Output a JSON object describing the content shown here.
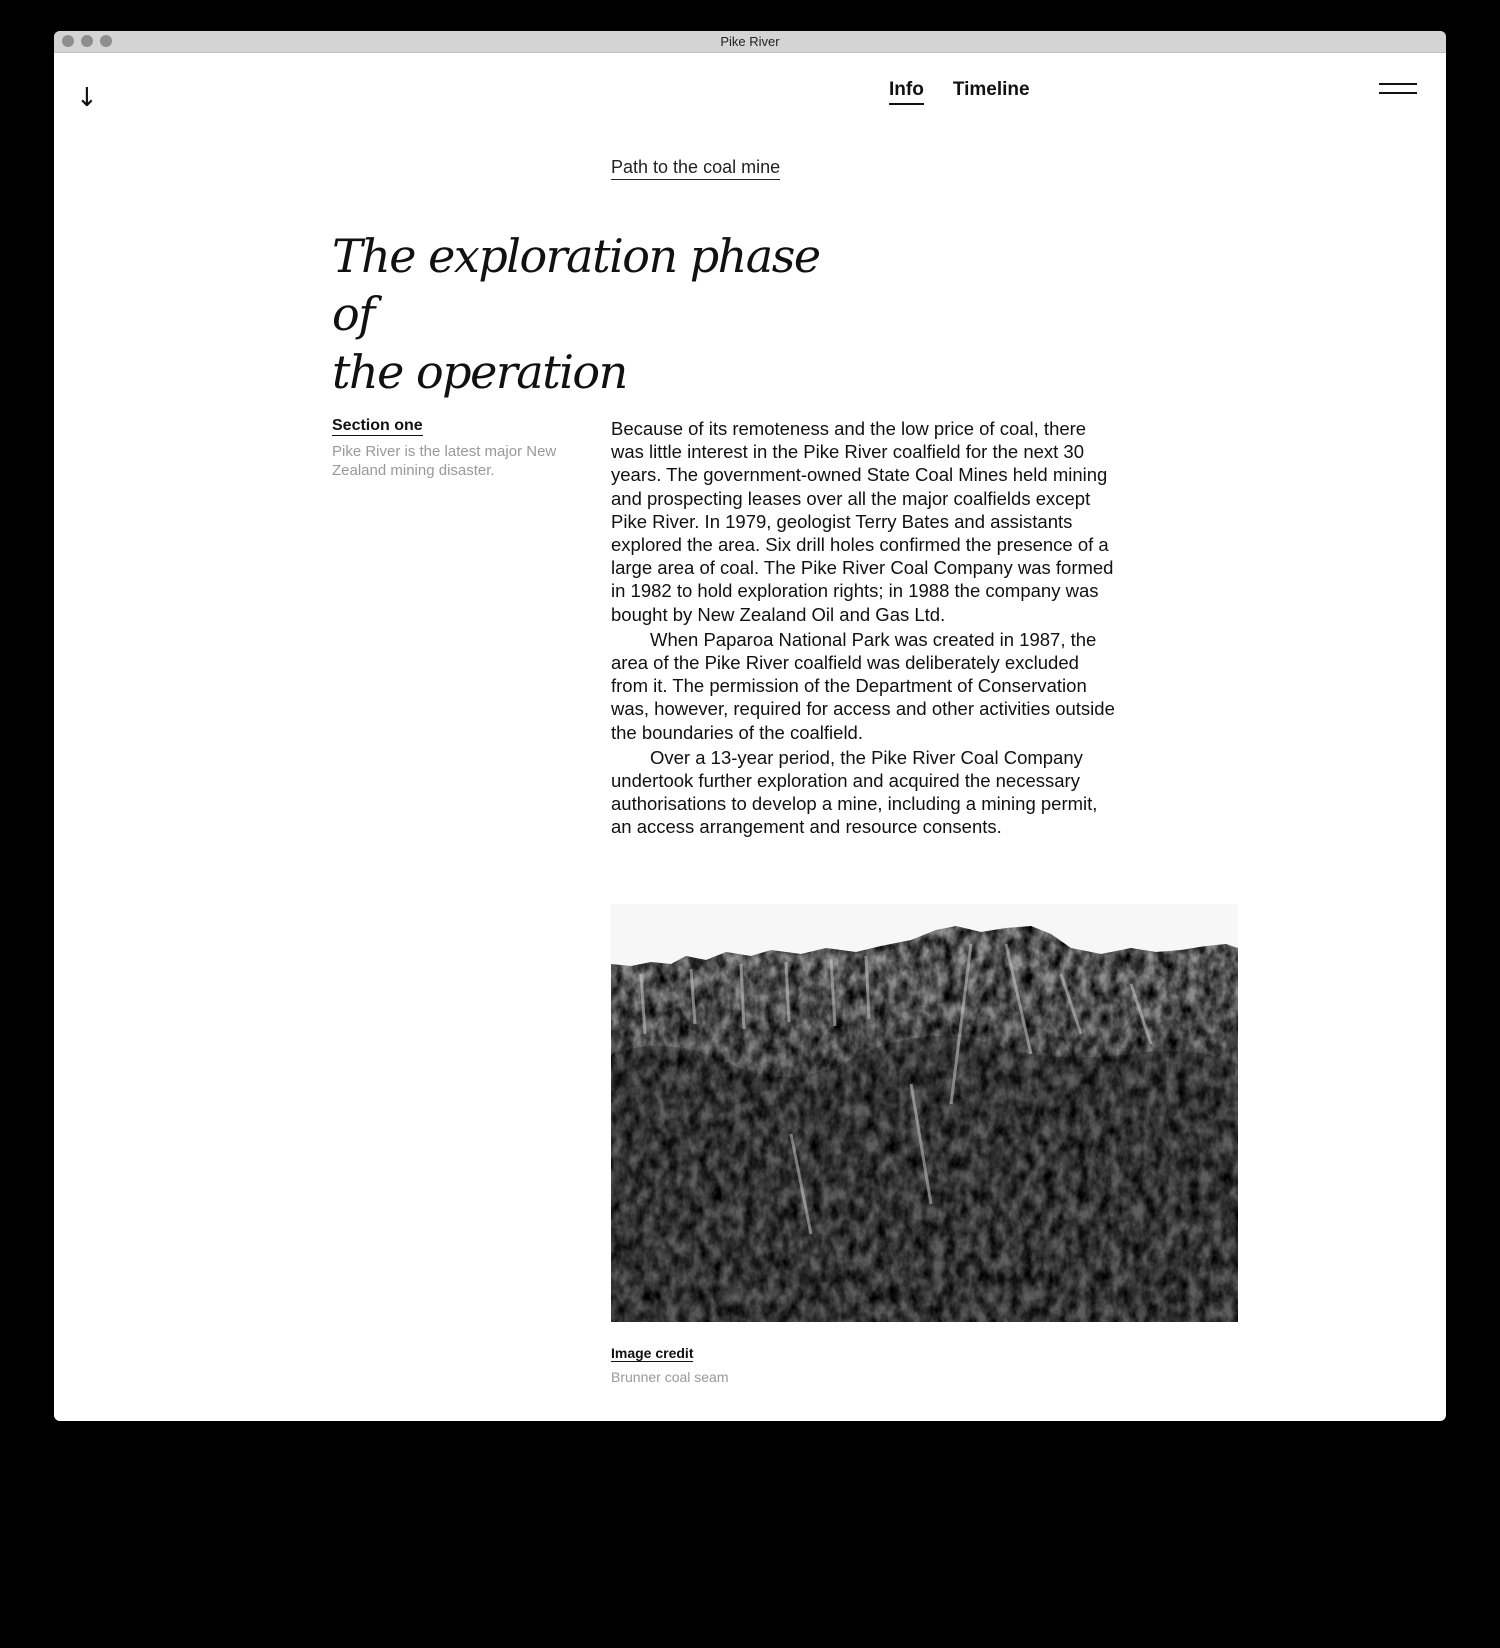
{
  "window": {
    "title": "Pike River"
  },
  "nav": {
    "items": [
      {
        "label": "Info",
        "active": true
      },
      {
        "label": "Timeline",
        "active": false
      }
    ]
  },
  "icons": {
    "scroll": "down-arrow-icon",
    "menu": "hamburger-menu-icon"
  },
  "breadcrumb": "Path to the coal mine",
  "title_line1": "The exploration phase of",
  "title_line2": "the operation",
  "aside": {
    "label": "Section one",
    "description": "Pike River is the latest major New Zealand mining disaster."
  },
  "paragraphs": [
    "Because of its remoteness and the low price of coal, there was little interest in the Pike River coalfield for the next 30 years. The government-owned State Coal Mines held mining and prospecting leases over all the major coalfields except Pike River. In 1979, geologist Terry Bates and assistants explored the area. Six drill holes confirmed the presence of a large area of coal. The Pike River Coal Company was formed in 1982 to hold exploration rights; in 1988 the company was bought by New Zealand Oil and Gas Ltd.",
    "When Paparoa National Park was created in 1987, the area of the Pike River coalfield was deliberately excluded from it. The permission of the Department of Conservation was, however, required for access and other activities outside the boundaries of the coalfield.",
    "Over a 13-year period, the Pike River Coal Company undertook further exploration and acquired the necessary authorisations to develop a mine, including a mining permit, an access arrangement and resource consents."
  ],
  "image": {
    "credit_label": "Image credit",
    "caption": "Brunner coal seam"
  },
  "colors": {
    "text": "#111111",
    "muted": "#999999",
    "background": "#ffffff",
    "titlebar": "#d4d4d4"
  }
}
